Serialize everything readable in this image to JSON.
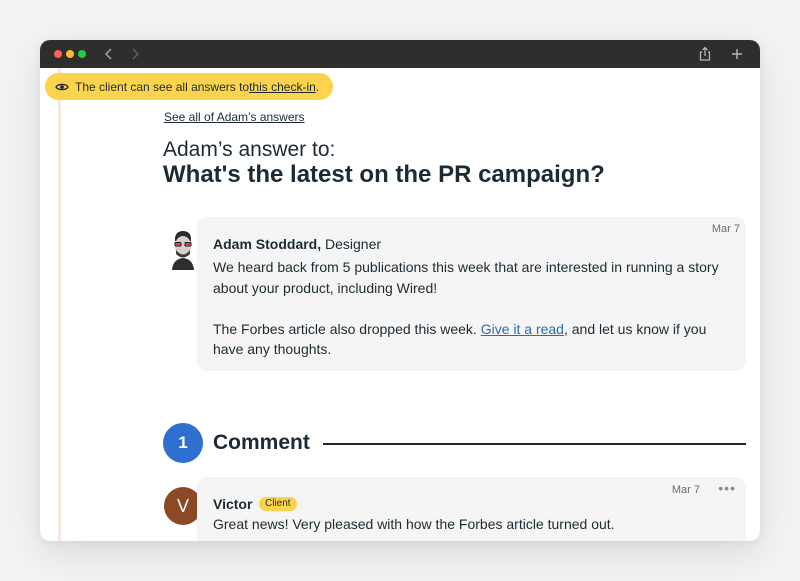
{
  "window": {
    "controls": [
      "close",
      "minimize",
      "zoom"
    ],
    "nav_icons": [
      "back-icon",
      "forward-icon"
    ],
    "action_icons": [
      "share-icon",
      "new-tab-icon"
    ],
    "accent": "#2f6fcf",
    "highlight": "#fcd34d"
  },
  "banner": {
    "prefix": "The client can see all answers to ",
    "link": "this check-in",
    "suffix": "."
  },
  "page": {
    "see_all_link": "See all of Adam’s answers",
    "answer_to": "Adam’s answer to:",
    "question": "What's the latest on the PR campaign?"
  },
  "answer": {
    "date": "Mar 7",
    "author_name": "Adam Stoddard,",
    "author_role": " Designer",
    "paragraph1": "We heard back from 5 publications this week that are interested in running a story about your product, including Wired!",
    "paragraph2_prefix": "The Forbes article also dropped this week. ",
    "paragraph2_link": "Give it a read",
    "paragraph2_suffix": ", and let us know if you have any thoughts."
  },
  "comments": {
    "count": "1",
    "label": "Comment",
    "items": [
      {
        "avatar_initial": "V",
        "author": "Victor",
        "badge": "Client",
        "date": "Mar 7",
        "more": "•••",
        "text": "Great news! Very pleased with how the Forbes article turned out."
      }
    ]
  }
}
